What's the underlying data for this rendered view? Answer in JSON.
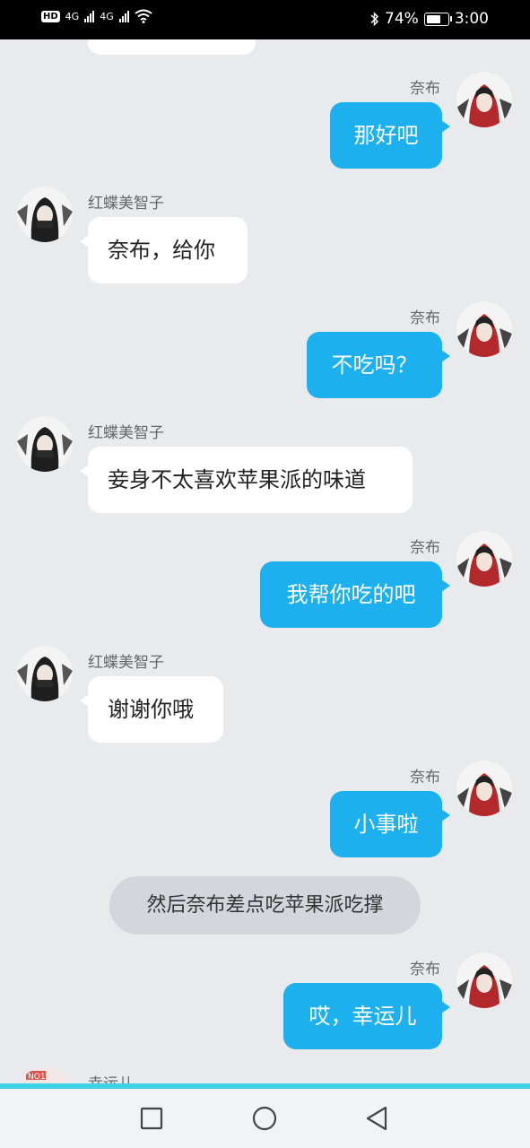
{
  "status_bar": {
    "network_1": "4G",
    "network_2": "4G",
    "battery_percent": "74%",
    "battery_level": 0.74,
    "time": "3:00"
  },
  "characters": {
    "nabu": "奈布",
    "michiko": "红蝶美智子",
    "lucky": "幸运儿"
  },
  "messages": [
    {
      "side": "right",
      "sender": "奈布",
      "text": "那好吧"
    },
    {
      "side": "left",
      "sender": "红蝶美智子",
      "text": "奈布，给你"
    },
    {
      "side": "right",
      "sender": "奈布",
      "text": "不吃吗？"
    },
    {
      "side": "left",
      "sender": "红蝶美智子",
      "text": "妾身不太喜欢苹果派的味道"
    },
    {
      "side": "right",
      "sender": "奈布",
      "text": "我帮你吃的吧"
    },
    {
      "side": "left",
      "sender": "红蝶美智子",
      "text": "谢谢你哦"
    },
    {
      "side": "right",
      "sender": "奈布",
      "text": "小事啦"
    },
    {
      "type": "narration",
      "text": "然后奈布差点吃苹果派吃撑"
    },
    {
      "side": "right",
      "sender": "奈布",
      "text": "哎，幸运儿"
    },
    {
      "side": "left",
      "sender": "幸运儿",
      "text": ""
    }
  ],
  "nav": {
    "recent_icon": "square-icon",
    "home_icon": "circle-icon",
    "back_icon": "triangle-back-icon"
  }
}
